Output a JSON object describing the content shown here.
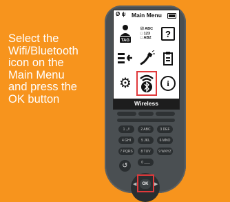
{
  "instruction": {
    "lines": [
      "Select the",
      "Wifi/Bluetooth",
      "icon on the",
      "Main Menu",
      "and press the",
      "OK button"
    ]
  },
  "screen": {
    "status_icons": "Ø ψ",
    "title": "Main Menu",
    "label": "Wireless",
    "menu": {
      "tag_label": "TAG",
      "abc_lines": [
        "☑ ABC",
        "□ 123",
        "□ AB2"
      ],
      "help_glyph": "?",
      "info_glyph": "i",
      "gear_glyph": "⚙",
      "wifi_glyph": "✱"
    }
  },
  "keypad": {
    "keys": [
      "1 .,/!",
      "2 ABC",
      "3 DEF",
      "4 GHI",
      "5 JKL",
      "6 MNO",
      "7 PQRS",
      "8 TUV",
      "9 WXYZ"
    ],
    "zero": "0 ___",
    "back_glyph": "↺",
    "ok_label": "OK"
  },
  "colors": {
    "background": "#f7941d",
    "device": "#4a4f52",
    "highlight": "#e0393b"
  }
}
